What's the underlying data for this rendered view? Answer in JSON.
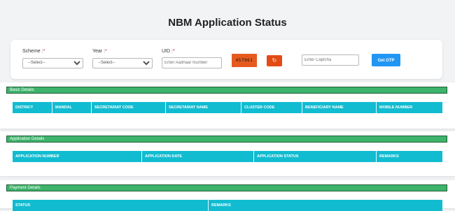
{
  "page": {
    "title": "NBM Application Status"
  },
  "filters": {
    "scheme": {
      "label": "Scheme :",
      "required_mark": "*",
      "selected": "--Select--"
    },
    "year": {
      "label": "Year :",
      "required_mark": "*",
      "selected": "--Select--"
    },
    "uid": {
      "label": "UID :",
      "required_mark": "*",
      "placeholder": "Enter Aadhaar Number"
    },
    "captcha": {
      "code": "457961",
      "refresh_icon": "refresh-icon",
      "placeholder": "Enter Captcha"
    },
    "get_otp_label": "Get OTP"
  },
  "sections": {
    "basic": {
      "title": "Basic Details",
      "columns": [
        "DISTRICT",
        "MANDAL",
        "SECRETARIAT CODE",
        "SECRETARIAT NAME",
        "CLUSTER CODE",
        "BENEFICIARY NAME",
        "MOBILE NUMBER"
      ]
    },
    "application": {
      "title": "Application Details",
      "columns": [
        "APPLICATION NUMBER",
        "APPLICATION DATE",
        "APPLICATION STATUS",
        "REMARKS"
      ]
    },
    "payment": {
      "title": "Payment Details",
      "columns": [
        "STATUS",
        "REMARKS"
      ]
    }
  },
  "colors": {
    "section_header": "#3db36b",
    "table_header": "#11bcd1",
    "otp_button": "#2196f3",
    "captcha_bg": "#e65a1e"
  }
}
